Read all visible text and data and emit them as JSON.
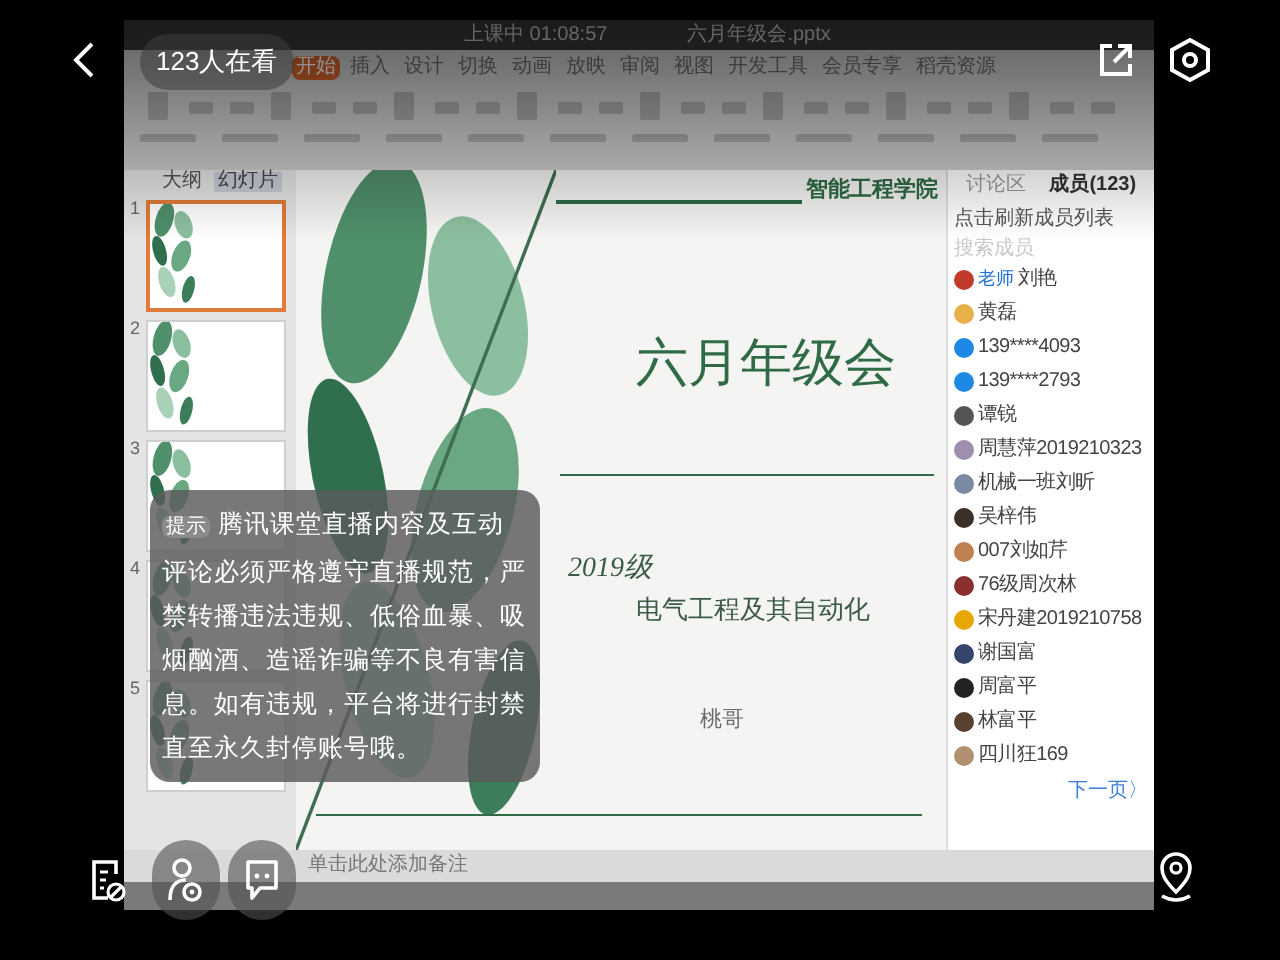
{
  "overlay": {
    "viewers": "123人在看"
  },
  "notice": {
    "tag": "提示",
    "text": "腾讯课堂直播内容及互动评论必须严格遵守直播规范，严禁转播违法违规、低俗血暴、吸烟酗酒、造谣诈骗等不良有害信息。如有违规，平台将进行封禁直至永久封停账号哦。"
  },
  "shared_screen": {
    "window_tabs": [
      {
        "label": "上课中 01:08:57"
      },
      {
        "label": "六月年级会.pptx"
      }
    ],
    "ribbon_tabs": [
      {
        "label": "开始",
        "selected": true
      },
      {
        "label": "插入",
        "selected": false
      },
      {
        "label": "设计",
        "selected": false
      },
      {
        "label": "切换",
        "selected": false
      },
      {
        "label": "动画",
        "selected": false
      },
      {
        "label": "放映",
        "selected": false
      },
      {
        "label": "审阅",
        "selected": false
      },
      {
        "label": "视图",
        "selected": false
      },
      {
        "label": "开发工具",
        "selected": false
      },
      {
        "label": "会员专享",
        "selected": false
      },
      {
        "label": "稻壳资源",
        "selected": false
      }
    ],
    "outline_tabs": [
      {
        "label": "大纲",
        "selected": false
      },
      {
        "label": "幻灯片",
        "selected": true
      }
    ],
    "thumbnails": [
      {
        "number": "1",
        "selected": true
      },
      {
        "number": "2",
        "selected": false
      },
      {
        "number": "3",
        "selected": false
      },
      {
        "number": "4",
        "selected": false
      },
      {
        "number": "5",
        "selected": false
      }
    ],
    "slide": {
      "school": "智能工程学院",
      "title": "六月年级会",
      "grade": "2019级",
      "major": "电气工程及其自动化",
      "author": "桃哥"
    },
    "notes_placeholder": "单击此处添加备注",
    "member_panel": {
      "tabs": [
        {
          "label": "讨论区",
          "selected": false
        },
        {
          "label": "成员(123)",
          "selected": true
        }
      ],
      "refresh": "点击刷新成员列表",
      "search_placeholder": "搜索成员",
      "members": [
        {
          "name": "刘艳",
          "badge": "老师",
          "color": "#c0392b"
        },
        {
          "name": "黄磊",
          "color": "#e8b04a"
        },
        {
          "name": "139****4093",
          "color": "#1e88e5"
        },
        {
          "name": "139****2793",
          "color": "#1e88e5"
        },
        {
          "name": "谭锐",
          "color": "#555555"
        },
        {
          "name": "周慧萍2019210323",
          "color": "#9e8fb0"
        },
        {
          "name": "机械一班刘昕",
          "color": "#7a8aa0"
        },
        {
          "name": "吴梓伟",
          "color": "#3b2f2a"
        },
        {
          "name": "007刘如芹",
          "color": "#c08050"
        },
        {
          "name": "76级周次林",
          "color": "#8a3030"
        },
        {
          "name": "宋丹建2019210758",
          "color": "#e6a800"
        },
        {
          "name": "谢国富",
          "color": "#34446a"
        },
        {
          "name": "周富平",
          "color": "#222222"
        },
        {
          "name": "林富平",
          "color": "#5a4030"
        },
        {
          "name": "四川狂169",
          "color": "#b09070"
        }
      ],
      "next": "下一页〉"
    }
  }
}
